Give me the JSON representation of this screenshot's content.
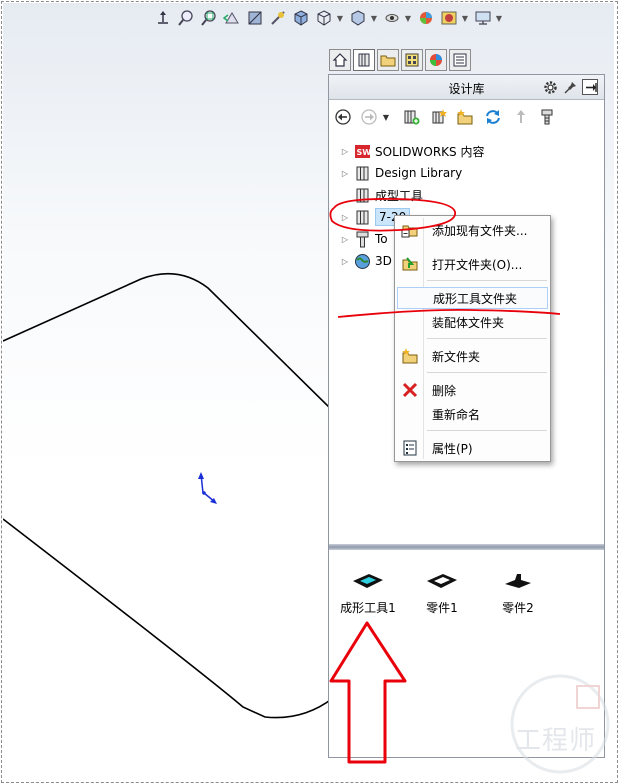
{
  "panel": {
    "title": "设计库"
  },
  "tree": [
    {
      "label": "SOLIDWORKS 内容",
      "icon": "solidworks-logo-icon",
      "expandable": true
    },
    {
      "label": "Design Library",
      "icon": "library-folder-icon",
      "expandable": true
    },
    {
      "label": "成型工具",
      "icon": "library-folder-icon",
      "expandable": false
    },
    {
      "label": "7-20",
      "icon": "library-folder-icon",
      "expandable": true,
      "selected": true
    },
    {
      "label": "To",
      "icon": "toolbox-icon",
      "expandable": true
    },
    {
      "label": "3D",
      "icon": "3d-content-central-icon",
      "expandable": true
    }
  ],
  "context_menu": {
    "items": [
      {
        "label": "添加现有文件夹...",
        "icon": "add-folder-icon"
      },
      {
        "label": "打开文件夹(O)...",
        "icon": "open-folder-icon"
      },
      {
        "label": "成形工具文件夹",
        "icon": "",
        "highlighted": true
      },
      {
        "label": "装配体文件夹",
        "icon": ""
      },
      {
        "label": "新文件夹",
        "icon": "new-folder-icon"
      },
      {
        "label": "删除",
        "icon": "delete-x-icon"
      },
      {
        "label": "重新命名",
        "icon": ""
      },
      {
        "label": "属性(P)",
        "icon": "properties-icon"
      }
    ]
  },
  "files": [
    {
      "label": "成形工具1"
    },
    {
      "label": "零件1"
    },
    {
      "label": "零件2"
    }
  ],
  "watermark": {
    "text": "工程师"
  },
  "colors": {
    "annotation_red": "#e8000b",
    "selection_blue": "#cbe5fb",
    "pane_border": "#8f96a0"
  }
}
